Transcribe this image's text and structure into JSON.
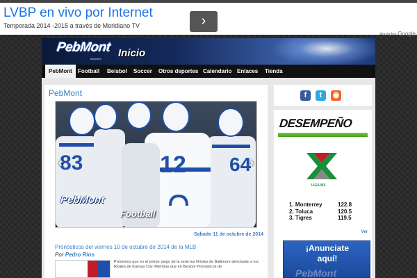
{
  "ad": {
    "title": "LVBP en vivo por Internet",
    "subtitle": "Temporada 2014 -2015 a través de Meridiano TV",
    "next_arrow": "›",
    "label_prefix": "Anuncios",
    "label_brand": "Google"
  },
  "header": {
    "logo": "PebMont",
    "logo_sub": "deportes",
    "page_heading": "Inicio"
  },
  "nav": {
    "items": [
      "PebMont",
      "Football",
      "Beisbol",
      "Soccer",
      "Otros deportes",
      "Calendario",
      "Enlaces",
      "Tienda"
    ]
  },
  "main": {
    "title": "PebMont",
    "slider": {
      "prev": "‹",
      "next": "›",
      "logo": "PebMont",
      "tag": "Football",
      "jersey_numbers": [
        "83",
        "12",
        "64"
      ]
    },
    "date": "Sabado 11 de octubre de 2014",
    "post": {
      "title": "Pronósticos del viernes 10 de octubre de 2014 de la MLB",
      "author_prefix": "Por",
      "author": "Pedro Ríos",
      "excerpt": "Prevemos que en el primer juego de la serie los Orioles de Baltimore derrotarán a los Reales de Kansas City. Mientras que en Beisbol Pronósticos de"
    }
  },
  "sidebar": {
    "social": [
      {
        "name": "facebook",
        "glyph": "f",
        "color": "#3b5998"
      },
      {
        "name": "twitter",
        "glyph": "t",
        "color": "#29a9e1"
      },
      {
        "name": "rss",
        "glyph": "◉",
        "color": "#f26522"
      }
    ],
    "performance": {
      "title": "DESEMPEÑO",
      "league": "LIGA MX",
      "standings": [
        {
          "rank": "1.",
          "team": "Monterrey",
          "points": "122.8"
        },
        {
          "rank": "2.",
          "team": "Toluca",
          "points": "120.5"
        },
        {
          "rank": "3.",
          "team": "Tigres",
          "points": "119.5"
        }
      ],
      "more_link": "Ver"
    },
    "promo": {
      "text_line1": "¡Anunciate",
      "text_line2": "aquí!"
    }
  },
  "colors": {
    "accent": "#3a7fc4",
    "nav_bg": "#111111",
    "header_blue": "#152a5c"
  }
}
